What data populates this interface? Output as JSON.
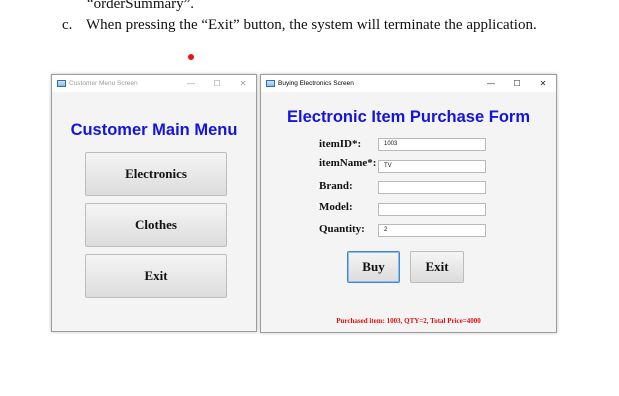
{
  "document": {
    "line1": "“orderSummary”.",
    "line2_marker": "c.",
    "line2_text": "When pressing the “Exit” button, the system will terminate the application."
  },
  "customer_window": {
    "title": "Customer Menu Screen",
    "heading": "Customer Main Menu",
    "buttons": {
      "electronics": "Electronics",
      "clothes": "Clothes",
      "exit": "Exit"
    }
  },
  "buying_window": {
    "title": "Buying Electronics Screen",
    "heading": "Electronic Item Purchase Form",
    "fields": [
      {
        "label": "itemID*:",
        "value": "1003"
      },
      {
        "label": "itemName*:",
        "value": "TV"
      },
      {
        "label": "Brand:",
        "value": ""
      },
      {
        "label": "Model:",
        "value": ""
      },
      {
        "label": "Quantity:",
        "value": "2"
      }
    ],
    "buy_label": "Buy",
    "exit_label": "Exit",
    "status_message": "Purchased item: 1003, QTY=2, Total Price=4000"
  },
  "window_controls": {
    "minimize": "—",
    "maximize": "☐",
    "close": "✕"
  },
  "colors": {
    "heading_blue": "#1414e0",
    "status_red": "#e01010",
    "dot_red": "#e0161b"
  },
  "icons": {
    "window_app": "window-app-icon",
    "bullet": "red-dot"
  }
}
